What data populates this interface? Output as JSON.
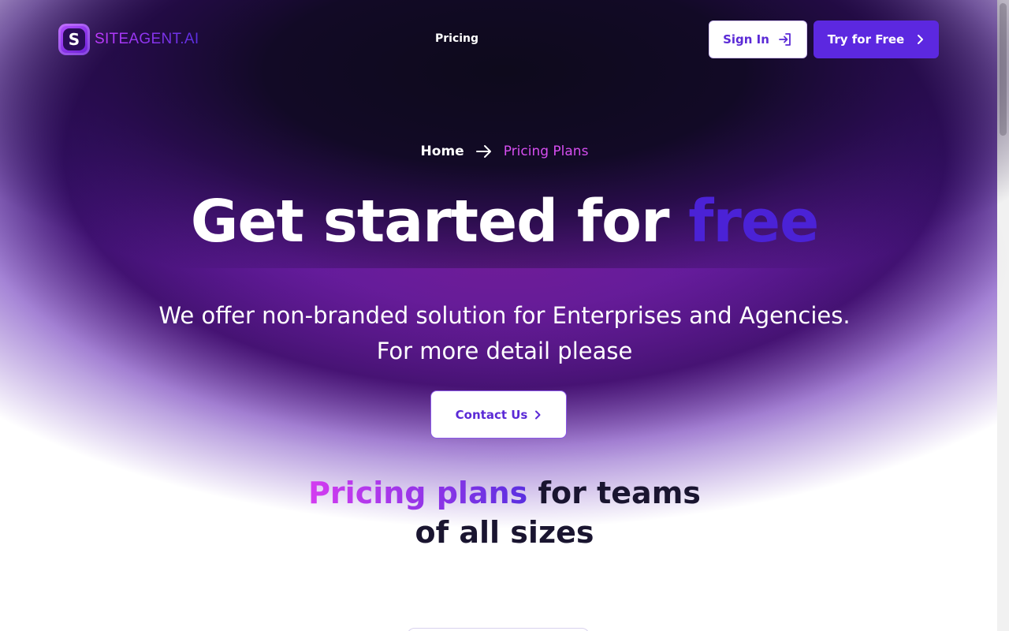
{
  "brand": {
    "name": "SITEAGENT.AI",
    "badge_letter": "S"
  },
  "nav": {
    "pricing": "Pricing"
  },
  "header": {
    "sign_in": "Sign In",
    "try_free": "Try for Free"
  },
  "breadcrumb": {
    "home": "Home",
    "current": "Pricing Plans"
  },
  "hero": {
    "headline_main": "Get started for ",
    "headline_accent": "free",
    "subline_1": "We offer non-branded solution for Enterprises and Agencies.",
    "subline_2": "For more detail please",
    "contact_button": "Contact Us"
  },
  "pricing": {
    "heading_highlight": "Pricing plans",
    "heading_rest": " for teams",
    "heading_line2": "of all sizes"
  },
  "colors": {
    "accent": "#5c28e0",
    "pink": "#d64ef0",
    "dark": "#120a26"
  },
  "icons": {
    "sign_in": "sign-in-icon",
    "chevron": "chevron-right-icon",
    "arrow": "arrow-right-icon"
  }
}
